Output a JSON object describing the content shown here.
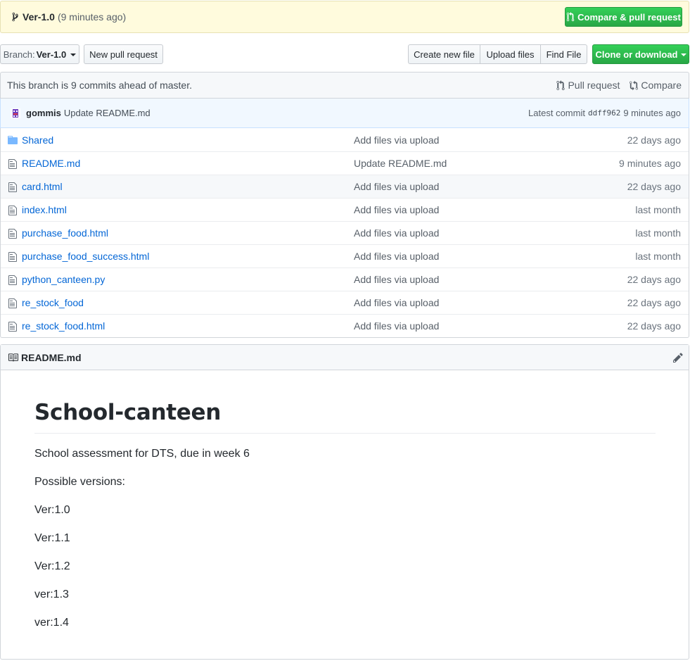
{
  "banner": {
    "branch": "Ver-1.0",
    "time": "(9 minutes ago)",
    "compare_button": "Compare & pull request"
  },
  "toolbar": {
    "branch_label": "Branch:",
    "branch_value": "Ver-1.0",
    "new_pr": "New pull request",
    "create_file": "Create new file",
    "upload_files": "Upload files",
    "find_file": "Find File",
    "clone": "Clone or download"
  },
  "branch_info": {
    "text": "This branch is 9 commits ahead of master.",
    "pull_request": "Pull request",
    "compare": "Compare"
  },
  "commit": {
    "author": "gommis",
    "message": "Update README.md",
    "latest_label": "Latest commit",
    "sha": "ddff962",
    "time": "9 minutes ago"
  },
  "files": [
    {
      "type": "folder",
      "name": "Shared",
      "message": "Add files via upload",
      "age": "22 days ago"
    },
    {
      "type": "file",
      "name": "README.md",
      "message": "Update README.md",
      "age": "9 minutes ago"
    },
    {
      "type": "file",
      "name": "card.html",
      "message": "Add files via upload",
      "age": "22 days ago"
    },
    {
      "type": "file",
      "name": "index.html",
      "message": "Add files via upload",
      "age": "last month"
    },
    {
      "type": "file",
      "name": "purchase_food.html",
      "message": "Add files via upload",
      "age": "last month"
    },
    {
      "type": "file",
      "name": "purchase_food_success.html",
      "message": "Add files via upload",
      "age": "last month"
    },
    {
      "type": "file",
      "name": "python_canteen.py",
      "message": "Add files via upload",
      "age": "22 days ago"
    },
    {
      "type": "file",
      "name": "re_stock_food",
      "message": "Add files via upload",
      "age": "22 days ago"
    },
    {
      "type": "file",
      "name": "re_stock_food.html",
      "message": "Add files via upload",
      "age": "22 days ago"
    }
  ],
  "readme": {
    "header": "README.md",
    "title": "School-canteen",
    "description": "School assessment for DTS, due in week 6",
    "versions_label": "Possible versions:",
    "versions": [
      "Ver:1.0",
      "Ver:1.1",
      "Ver:1.2",
      "ver:1.3",
      "ver:1.4"
    ]
  }
}
